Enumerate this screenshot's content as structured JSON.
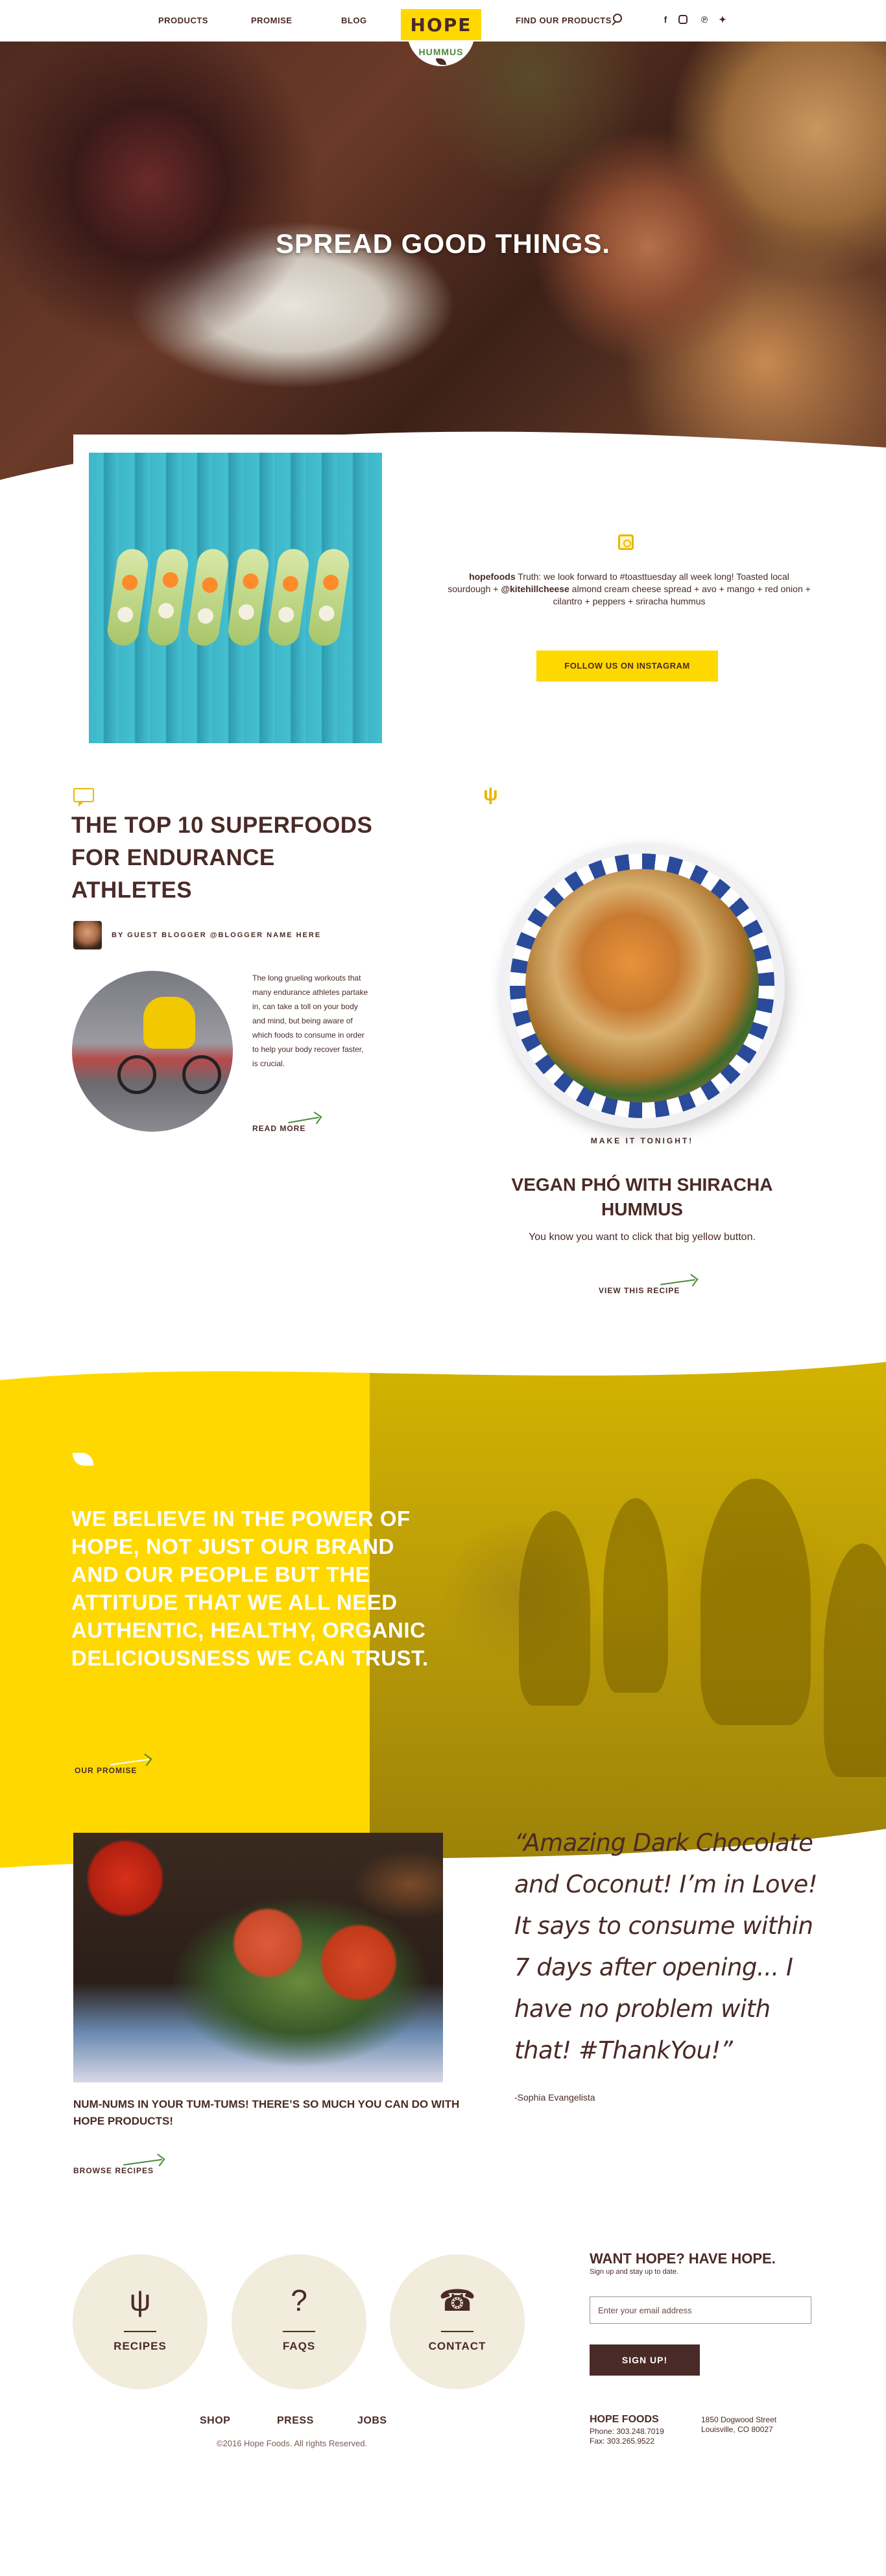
{
  "nav": {
    "products": "PRODUCTS",
    "promise": "PROMISE",
    "blog": "BLOG",
    "logo_main": "HOPE",
    "logo_sub": "HUMMUS",
    "find": "FIND OUR PRODUCTS",
    "social_icons": [
      "facebook-icon",
      "instagram-icon",
      "pinterest-icon",
      "twitter-icon"
    ]
  },
  "hero": {
    "title": "SPREAD GOOD THINGS."
  },
  "instagram": {
    "handle": "hopefoods",
    "text_before": " Truth: we look forward to #toasttuesday all week long! Toasted local sourdough + ",
    "mention": "@kitehillcheese",
    "text_after": " almond cream cheese spread + avo + mango + red onion + cilantro + peppers + sriracha hummus",
    "button": "FOLLOW US ON INSTAGRAM"
  },
  "article": {
    "title": "THE TOP 10 SUPERFOODS FOR ENDURANCE ATHLETES",
    "byline": "BY GUEST BLOGGER @BLOGGER NAME HERE",
    "body": "The long grueling workouts that many endurance athletes partake in, can take a toll on your body and mind, but being aware of which foods to consume in order to help your body recover faster, is crucial.",
    "read_more": "READ MORE"
  },
  "recipe": {
    "kicker": "MAKE IT TONIGHT!",
    "title": "VEGAN PHÓ WITH SHIRACHA HUMMUS",
    "desc": "You know you want to click that big yellow button.",
    "link": "VIEW THIS RECIPE"
  },
  "mission": {
    "text": "WE BELIEVE IN THE POWER OF HOPE, NOT JUST OUR BRAND AND OUR PEOPLE BUT THE ATTITUDE THAT WE ALL NEED AUTHENTIC, HEALTHY, ORGANIC DELICIOUSNESS WE CAN TRUST.",
    "link": "OUR PROMISE"
  },
  "testimonial": {
    "quote": "“Amazing Dark Chocolate and Coconut! I’m in Love! It says to consume within 7 days after opening... I have no problem with that! #ThankYou!”",
    "author": "-Sophia Evangelista",
    "promo": "NUM-NUMS IN YOUR TUM-TUMS! THERE’S SO MUCH YOU CAN DO WITH HOPE PRODUCTS!",
    "link": "BROWSE RECIPES"
  },
  "footer": {
    "circles": [
      {
        "label": "RECIPES",
        "icon": "utensils-icon"
      },
      {
        "label": "FAQS",
        "icon": "question-icon"
      },
      {
        "label": "CONTACT",
        "icon": "contact-card-icon"
      }
    ],
    "signup_title": "WANT HOPE? HAVE HOPE.",
    "signup_sub": "Sign up and stay up to date.",
    "email_placeholder": "Enter your email address",
    "signup_button": "SIGN UP!",
    "links": [
      "SHOP",
      "PRESS",
      "JOBS"
    ],
    "copyright": "©2016 Hope Foods. All rights Reserved.",
    "company": "HOPE FOODS",
    "phone": "Phone: 303.248.7019",
    "fax": "Fax: 303.265.9522",
    "address1": "1850 Dogwood Street",
    "address2": "Louisville, CO 80027"
  },
  "colors": {
    "brand_yellow": "#ffd800",
    "brand_brown": "#4a2a27",
    "leaf_green": "#4a8a3a",
    "cream": "#f1ecdc"
  }
}
